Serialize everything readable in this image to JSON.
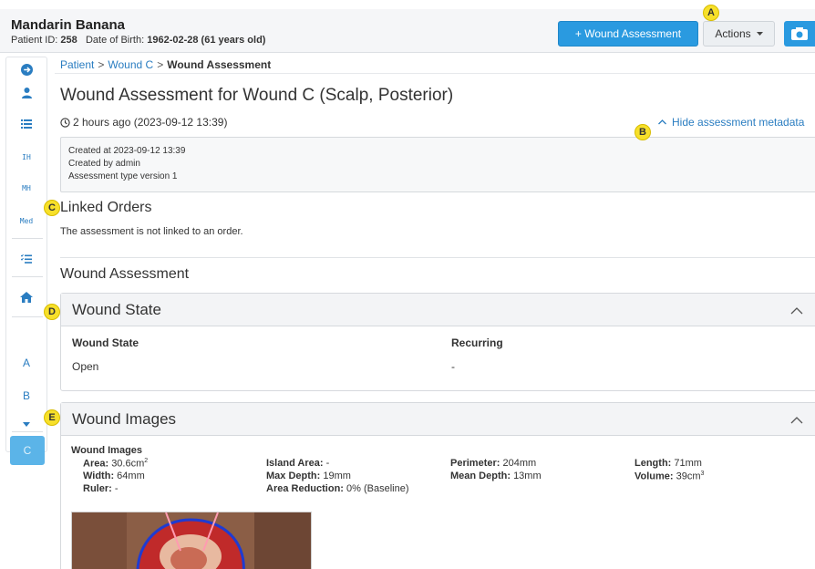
{
  "header": {
    "patient_name": "Mandarin Banana",
    "patient_id_label": "Patient ID:",
    "patient_id": "258",
    "dob_label": "Date of Birth:",
    "dob": "1962-02-28 (61 years old)",
    "wound_assessment_button": "+ Wound Assessment",
    "actions_button": "Actions",
    "camera_icon": "camera-icon",
    "accent_color": "#2a9ae0"
  },
  "sidebar": {
    "icons": [
      "arrow-circle-right-icon",
      "person-icon",
      "list-icon",
      "checklist-icon",
      "home-icon",
      "caret-down-icon"
    ],
    "text_items": [
      "IH",
      "MH",
      "Med"
    ],
    "wound_letters": [
      "A",
      "B"
    ],
    "active_wound": "C"
  },
  "breadcrumb": {
    "items": [
      "Patient",
      "Wound C",
      "Wound Assessment"
    ],
    "separator": ">"
  },
  "page": {
    "title": "Wound Assessment for Wound C (Scalp, Posterior)",
    "timestamp": "2 hours ago (2023-09-12 13:39)",
    "hide_metadata_link": "Hide assessment metadata"
  },
  "metadata": {
    "created_at": "Created at 2023-09-12 13:39",
    "created_by": "Created by admin",
    "type_version": "Assessment type version 1"
  },
  "linked_orders": {
    "title": "Linked Orders",
    "text": "The assessment is not linked to an order."
  },
  "wound_assessment": {
    "title": "Wound Assessment",
    "state_panel": {
      "title": "Wound State",
      "col1_label": "Wound State",
      "col1_value": "Open",
      "col2_label": "Recurring",
      "col2_value": "-"
    },
    "images_panel": {
      "title": "Wound Images",
      "subtitle": "Wound Images",
      "metrics": {
        "area_label": "Area:",
        "area": "30.6cm",
        "area_sup": "2",
        "island_label": "Island Area:",
        "island": "-",
        "perimeter_label": "Perimeter:",
        "perimeter": "204mm",
        "length_label": "Length:",
        "length": "71mm",
        "width_label": "Width:",
        "width": "64mm",
        "maxdepth_label": "Max Depth:",
        "maxdepth": "19mm",
        "meandepth_label": "Mean Depth:",
        "meandepth": "13mm",
        "volume_label": "Volume:",
        "volume": "39cm",
        "volume_sup": "3",
        "ruler_label": "Ruler:",
        "ruler": "-",
        "reduction_label": "Area Reduction:",
        "reduction": "0% (Baseline)"
      }
    }
  },
  "callouts": [
    "A",
    "B",
    "C",
    "D",
    "E"
  ]
}
